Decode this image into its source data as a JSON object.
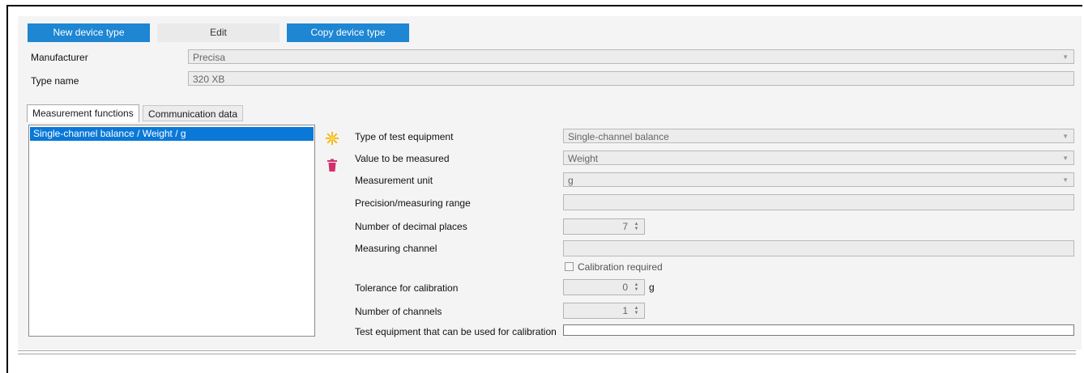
{
  "toolbar": {
    "new_label": "New device type",
    "edit_label": "Edit",
    "copy_label": "Copy device type"
  },
  "header": {
    "manufacturer_label": "Manufacturer",
    "manufacturer_value": "Precisa",
    "type_name_label": "Type name",
    "type_name_value": "320 XB"
  },
  "tabs": [
    {
      "label": "Measurement functions",
      "active": true
    },
    {
      "label": "Communication data",
      "active": false
    }
  ],
  "functions_list": [
    "Single-channel balance / Weight / g"
  ],
  "icons": {
    "add": "sun-icon",
    "delete": "trash-icon"
  },
  "form": {
    "test_equipment_type": {
      "label": "Type of test equipment",
      "value": "Single-channel balance"
    },
    "value_measured": {
      "label": "Value to be measured",
      "value": "Weight"
    },
    "unit": {
      "label": "Measurement unit",
      "value": "g"
    },
    "precision": {
      "label": "Precision/measuring range",
      "value": ""
    },
    "decimals": {
      "label": "Number of decimal places",
      "value": "7"
    },
    "channel": {
      "label": "Measuring channel",
      "value": ""
    },
    "calibration_required": {
      "label": "Calibration required",
      "checked": false
    },
    "tolerance": {
      "label": "Tolerance for calibration",
      "value": "0",
      "unit": "g"
    },
    "channels": {
      "label": "Number of channels",
      "value": "1"
    },
    "calib_equipment": {
      "label": "Test equipment that can be used for calibration",
      "value": ""
    }
  },
  "colors": {
    "accent": "#1e86d2",
    "selection": "#0a78d7",
    "add_icon": "#f5b400",
    "delete_icon": "#d4306f"
  }
}
